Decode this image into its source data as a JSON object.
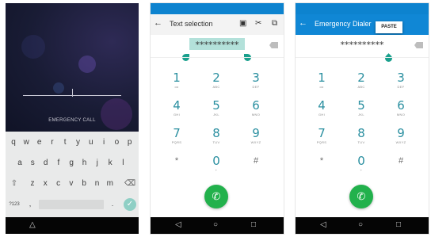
{
  "lock": {
    "emergency_label": "EMERGENCY CALL",
    "keyboard": {
      "row1": [
        "q",
        "w",
        "e",
        "r",
        "t",
        "y",
        "u",
        "i",
        "o",
        "p"
      ],
      "row2": [
        "a",
        "s",
        "d",
        "f",
        "g",
        "h",
        "j",
        "k",
        "l"
      ],
      "row3": [
        "z",
        "x",
        "c",
        "v",
        "b",
        "n",
        "m"
      ],
      "shift": "⇧",
      "delete": "⌫",
      "num_key": "?123",
      "comma": ",",
      "period": ".",
      "enter": "✓"
    }
  },
  "text_selection": {
    "title": "Text selection",
    "back": "←",
    "select_all_icon": "▣",
    "cut_icon": "✂",
    "copy_icon": "⧉",
    "digits": "**********"
  },
  "emergency": {
    "title": "Emergency Dialer",
    "back": "←",
    "paste": "PASTE",
    "digits": "**********"
  },
  "dialpad": [
    {
      "d": "1",
      "l": "oo"
    },
    {
      "d": "2",
      "l": "ABC"
    },
    {
      "d": "3",
      "l": "DEF"
    },
    {
      "d": "4",
      "l": "GHI"
    },
    {
      "d": "5",
      "l": "JKL"
    },
    {
      "d": "6",
      "l": "MNO"
    },
    {
      "d": "7",
      "l": "PQRS"
    },
    {
      "d": "8",
      "l": "TUV"
    },
    {
      "d": "9",
      "l": "WXYZ"
    },
    {
      "d": "*",
      "l": ""
    },
    {
      "d": "0",
      "l": "+"
    },
    {
      "d": "#",
      "l": ""
    }
  ],
  "nav": {
    "back": "◁",
    "home": "○",
    "recent": "□"
  },
  "call_icon": "✆",
  "colors": {
    "status_bar": "#0d83cf",
    "emergency_bar": "#1087d5",
    "digit": "#2a8fa0",
    "call_button": "#22b14c",
    "selection": "#b3e1da",
    "handle": "#1aa08d"
  }
}
